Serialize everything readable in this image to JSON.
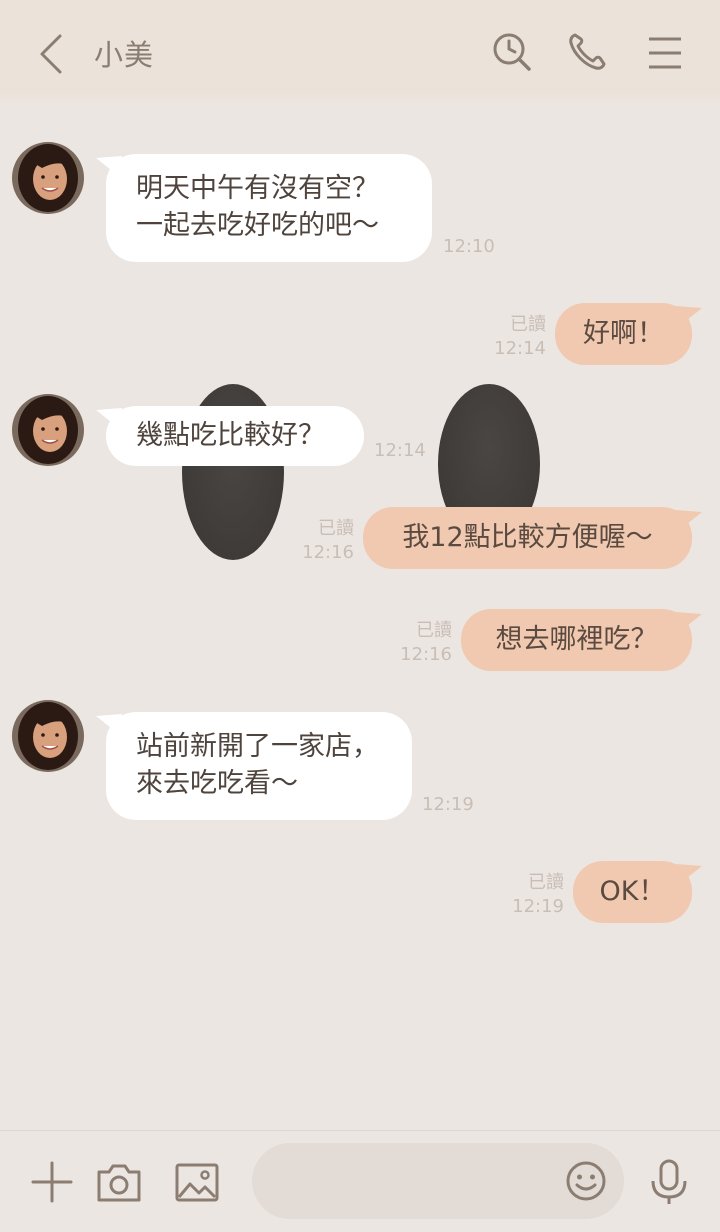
{
  "header": {
    "title": "小美"
  },
  "messages": [
    {
      "side": "in",
      "text": "明天中午有沒有空？\n一起去吃好吃的吧〜",
      "time": "12:10"
    },
    {
      "side": "out",
      "text": "好啊！",
      "read": "已讀",
      "time": "12:14"
    },
    {
      "side": "in",
      "text": "幾點吃比較好？",
      "time": "12:14"
    },
    {
      "side": "out",
      "text": "我12點比較方便喔〜",
      "read": "已讀",
      "time": "12:16"
    },
    {
      "side": "out",
      "text": "想去哪裡吃？",
      "read": "已讀",
      "time": "12:16"
    },
    {
      "side": "in",
      "text": "站前新開了一家店，\n來去吃吃看〜",
      "time": "12:19"
    },
    {
      "side": "out",
      "text": "OK！",
      "read": "已讀",
      "time": "12:19"
    }
  ],
  "icons": {
    "back": "chevron-left-icon",
    "search": "search-clock-icon",
    "call": "phone-icon",
    "menu": "hamburger-menu-icon",
    "add": "plus-icon",
    "camera": "camera-icon",
    "image": "image-icon",
    "emoji": "smiley-icon",
    "mic": "microphone-icon"
  },
  "colors": {
    "background": "#ece6e2",
    "header": "#ebe3da",
    "bubble_in": "#ffffff",
    "bubble_out": "#f0c9b0",
    "icon": "#8b7d71",
    "meta_text": "#c9beb5"
  }
}
